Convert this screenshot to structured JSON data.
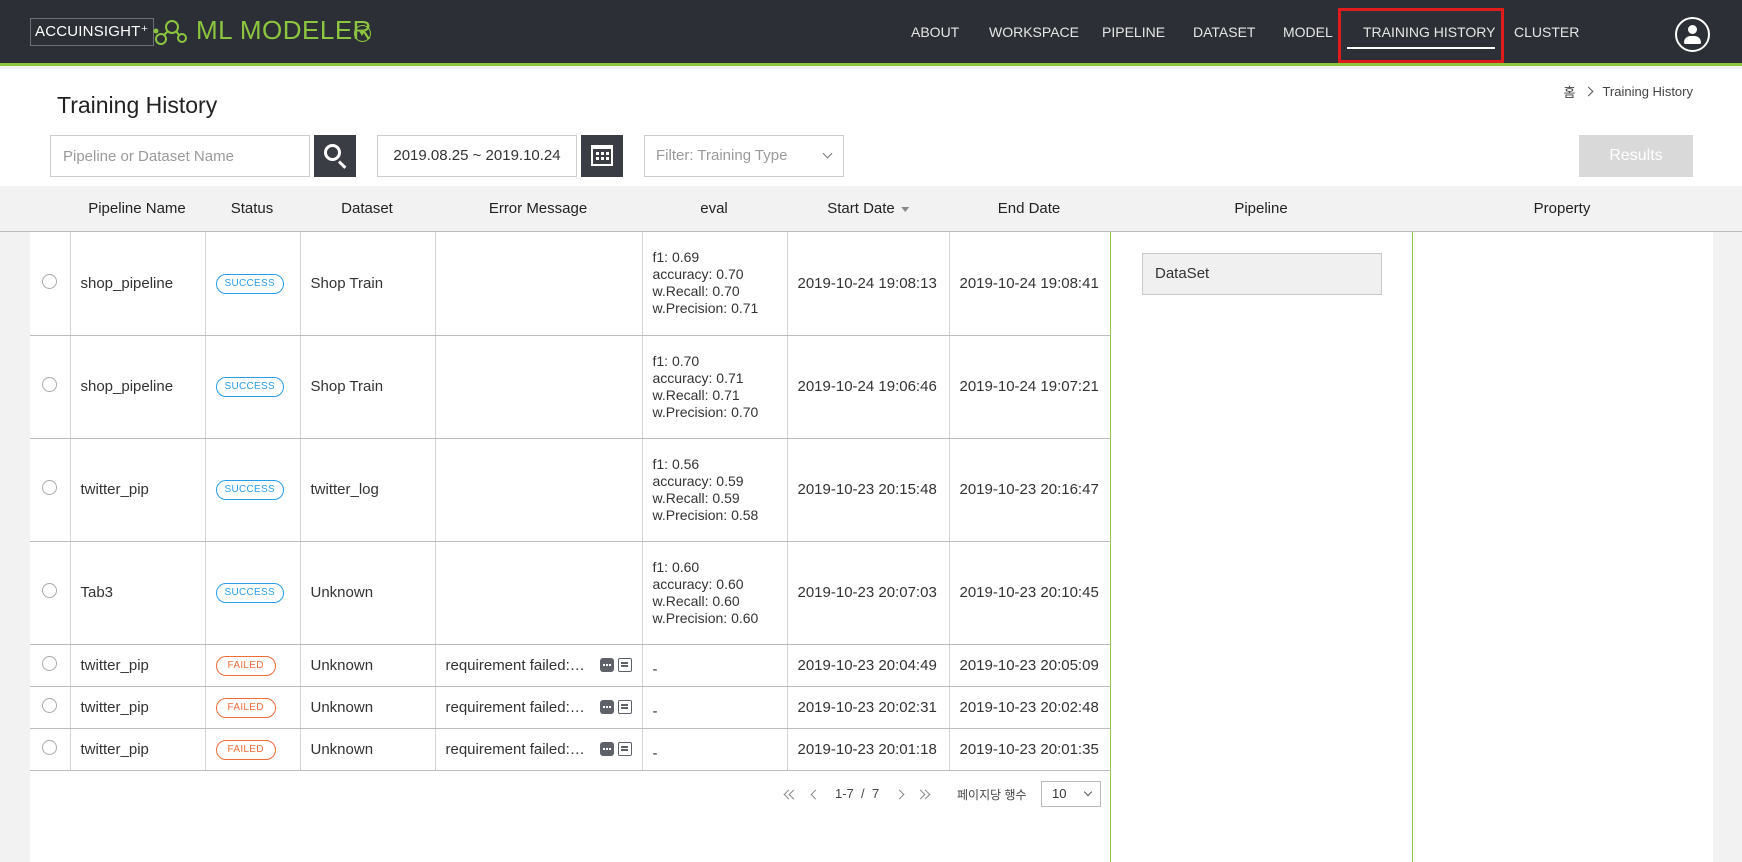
{
  "brand": {
    "company": "ACCUINSIGHT⁺",
    "product": "ML MODELER"
  },
  "nav": {
    "items": [
      "ABOUT",
      "WORKSPACE",
      "PIPELINE",
      "DATASET",
      "MODEL",
      "TRAINING HISTORY",
      "CLUSTER"
    ],
    "active": "TRAINING HISTORY"
  },
  "page": {
    "title": "Training History"
  },
  "breadcrumb": {
    "home": "홈",
    "current": "Training History"
  },
  "toolbar": {
    "search_placeholder": "Pipeline or Dataset Name",
    "date_range": "2019.08.25 ~ 2019.10.24",
    "filter_placeholder": "Filter: Training Type",
    "results_label": "Results"
  },
  "table": {
    "headers": {
      "pipeline_name": "Pipeline Name",
      "status": "Status",
      "dataset": "Dataset",
      "error_message": "Error Message",
      "eval": "eval",
      "start_date": "Start Date",
      "end_date": "End Date",
      "pipeline": "Pipeline",
      "property": "Property"
    },
    "rows": [
      {
        "pipeline": "shop_pipeline",
        "status": "SUCCESS",
        "dataset": "Shop Train",
        "error": "",
        "eval": [
          "f1: 0.69",
          "accuracy: 0.70",
          "w.Recall: 0.70",
          "w.Precision: 0.71"
        ],
        "start": "2019-10-24 19:08:13",
        "end": "2019-10-24 19:08:41"
      },
      {
        "pipeline": "shop_pipeline",
        "status": "SUCCESS",
        "dataset": "Shop Train",
        "error": "",
        "eval": [
          "f1: 0.70",
          "accuracy: 0.71",
          "w.Recall: 0.71",
          "w.Precision: 0.70"
        ],
        "start": "2019-10-24 19:06:46",
        "end": "2019-10-24 19:07:21"
      },
      {
        "pipeline": "twitter_pip",
        "status": "SUCCESS",
        "dataset": "twitter_log",
        "error": "",
        "eval": [
          "f1: 0.56",
          "accuracy: 0.59",
          "w.Recall: 0.59",
          "w.Precision: 0.58"
        ],
        "start": "2019-10-23 20:15:48",
        "end": "2019-10-23 20:16:47"
      },
      {
        "pipeline": "Tab3",
        "status": "SUCCESS",
        "dataset": "Unknown",
        "error": "",
        "eval": [
          "f1: 0.60",
          "accuracy: 0.60",
          "w.Recall: 0.60",
          "w.Precision: 0.60"
        ],
        "start": "2019-10-23 20:07:03",
        "end": "2019-10-23 20:10:45"
      },
      {
        "pipeline": "twitter_pip",
        "status": "FAILED",
        "dataset": "Unknown",
        "error": "requirement failed: ···",
        "eval": [
          "-"
        ],
        "start": "2019-10-23 20:04:49",
        "end": "2019-10-23 20:05:09"
      },
      {
        "pipeline": "twitter_pip",
        "status": "FAILED",
        "dataset": "Unknown",
        "error": "requirement failed: ···",
        "eval": [
          "-"
        ],
        "start": "2019-10-23 20:02:31",
        "end": "2019-10-23 20:02:48"
      },
      {
        "pipeline": "twitter_pip",
        "status": "FAILED",
        "dataset": "Unknown",
        "error": "requirement failed: ···",
        "eval": [
          "-"
        ],
        "start": "2019-10-23 20:01:18",
        "end": "2019-10-23 20:01:35"
      }
    ]
  },
  "pagination": {
    "range": "1-7",
    "separator": "/",
    "total": "7",
    "rows_per_page_label": "페이지당 행수",
    "rows_per_page": "10"
  },
  "pipeline_panel": {
    "node": "DataSet"
  },
  "colors": {
    "accent": "#8cc63f",
    "nav_bg": "#2c2f35",
    "success": "#2a9ee8",
    "failed": "#f06d3a",
    "highlight": "#e01b1b"
  }
}
